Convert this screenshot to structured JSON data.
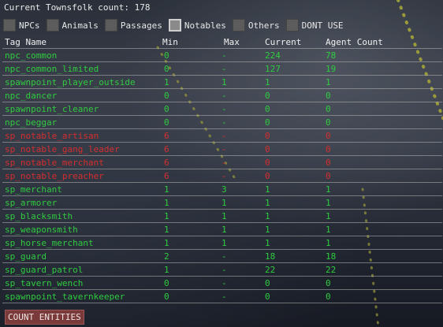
{
  "header": {
    "label": "Current Townsfolk count:",
    "count": "178"
  },
  "filters": [
    {
      "label": "NPCs",
      "checked": false
    },
    {
      "label": "Animals",
      "checked": false
    },
    {
      "label": "Passages",
      "checked": false
    },
    {
      "label": "Notables",
      "checked": true
    },
    {
      "label": "Others",
      "checked": false
    },
    {
      "label": "DONT USE",
      "checked": false
    }
  ],
  "table": {
    "columns": [
      "Tag Name",
      "Min",
      "Max",
      "Current",
      "Agent Count"
    ],
    "rows": [
      {
        "tag": "npc_common",
        "min": "0",
        "max": "-",
        "current": "224",
        "agent": "78",
        "color": "green"
      },
      {
        "tag": "npc_common_limited",
        "min": "0",
        "max": "-",
        "current": "127",
        "agent": "19",
        "color": "green"
      },
      {
        "tag": "spawnpoint_player_outside",
        "min": "1",
        "max": "1",
        "current": "1",
        "agent": "1",
        "color": "green"
      },
      {
        "tag": "npc_dancer",
        "min": "0",
        "max": "-",
        "current": "0",
        "agent": "0",
        "color": "green"
      },
      {
        "tag": "spawnpoint_cleaner",
        "min": "0",
        "max": "-",
        "current": "0",
        "agent": "0",
        "color": "green"
      },
      {
        "tag": "npc_beggar",
        "min": "0",
        "max": "-",
        "current": "0",
        "agent": "0",
        "color": "green"
      },
      {
        "tag": "sp_notable_artisan",
        "min": "6",
        "max": "-",
        "current": "0",
        "agent": "0",
        "color": "red"
      },
      {
        "tag": "sp_notable_gang_leader",
        "min": "6",
        "max": "-",
        "current": "0",
        "agent": "0",
        "color": "red"
      },
      {
        "tag": "sp_notable_merchant",
        "min": "6",
        "max": "-",
        "current": "0",
        "agent": "0",
        "color": "red"
      },
      {
        "tag": "sp_notable_preacher",
        "min": "6",
        "max": "-",
        "current": "0",
        "agent": "0",
        "color": "red"
      },
      {
        "tag": "sp_merchant",
        "min": "1",
        "max": "3",
        "current": "1",
        "agent": "1",
        "color": "green"
      },
      {
        "tag": "sp_armorer",
        "min": "1",
        "max": "1",
        "current": "1",
        "agent": "1",
        "color": "green"
      },
      {
        "tag": "sp_blacksmith",
        "min": "1",
        "max": "1",
        "current": "1",
        "agent": "1",
        "color": "green"
      },
      {
        "tag": "sp_weaponsmith",
        "min": "1",
        "max": "1",
        "current": "1",
        "agent": "1",
        "color": "green"
      },
      {
        "tag": "sp_horse_merchant",
        "min": "1",
        "max": "1",
        "current": "1",
        "agent": "1",
        "color": "green"
      },
      {
        "tag": "sp_guard",
        "min": "2",
        "max": "-",
        "current": "18",
        "agent": "18",
        "color": "green"
      },
      {
        "tag": "sp_guard_patrol",
        "min": "1",
        "max": "-",
        "current": "22",
        "agent": "22",
        "color": "green"
      },
      {
        "tag": "sp_tavern_wench",
        "min": "0",
        "max": "-",
        "current": "0",
        "agent": "0",
        "color": "green"
      },
      {
        "tag": "spawnpoint_tavernkeeper",
        "min": "0",
        "max": "-",
        "current": "0",
        "agent": "0",
        "color": "green"
      }
    ]
  },
  "button": {
    "label": "COUNT ENTITIES"
  },
  "colors": {
    "ok": "#2fcb3f",
    "warn": "#d52e2e",
    "button": "#7a3a3a"
  }
}
